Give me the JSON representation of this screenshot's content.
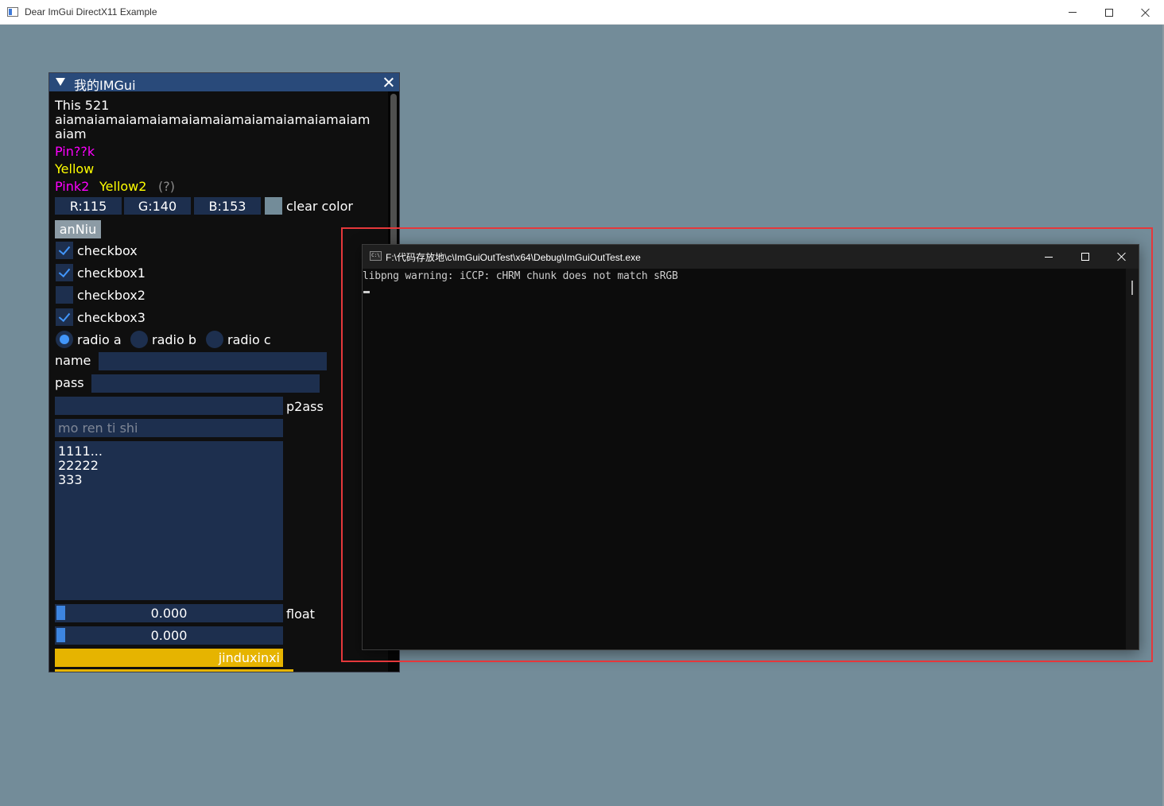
{
  "os_window": {
    "title": "Dear ImGui DirectX11 Example",
    "background_color": "#738c99"
  },
  "imgui_window": {
    "title": "我的IMGui",
    "text_lines": [
      "This 521",
      "aiamaiamaiamaiamaiamaiamaiamaiamaiamaiam",
      "aiam"
    ],
    "pink_text": "Pin??k",
    "yellow_text": "Yellow",
    "pink2_text": "Pink2",
    "yellow2_text": "Yellow2",
    "help_marker": "(?)",
    "color_r": "R:115",
    "color_g": "G:140",
    "color_b": "B:153",
    "clear_color_label": "clear color",
    "clear_color_value": "#738c99",
    "button_label": "anNiu",
    "checkboxes": [
      {
        "label": "checkbox",
        "checked": true
      },
      {
        "label": "checkbox1",
        "checked": true
      },
      {
        "label": "checkbox2",
        "checked": false
      },
      {
        "label": "checkbox3",
        "checked": true
      }
    ],
    "radios": [
      {
        "label": "radio a",
        "selected": true
      },
      {
        "label": "radio b",
        "selected": false
      },
      {
        "label": "radio c",
        "selected": false
      }
    ],
    "name_label": "name",
    "pass_label": "pass",
    "p2ass_label": "p2ass",
    "hint_placeholder": "mo ren ti shi",
    "multiline_lines": [
      "1111...",
      "22222",
      "333"
    ],
    "slider1_value": "0.000",
    "slider2_value": "0.000",
    "float_label": "float",
    "progress_label": "jinduxinxi",
    "progress_fraction": 1.0,
    "colors": {
      "pink": "#ff00ff",
      "yellow": "#ffff00",
      "frame": "#1d2f4e",
      "title": "#294a7a",
      "accent": "#4296fa",
      "progress": "#e6b400"
    }
  },
  "console": {
    "title": "F:\\代码存放地\\c\\ImGuiOutTest\\x64\\Debug\\ImGuiOutTest.exe",
    "icon_text": "C:\\",
    "output_line": "libpng warning: iCCP: cHRM chunk does not match sRGB"
  }
}
